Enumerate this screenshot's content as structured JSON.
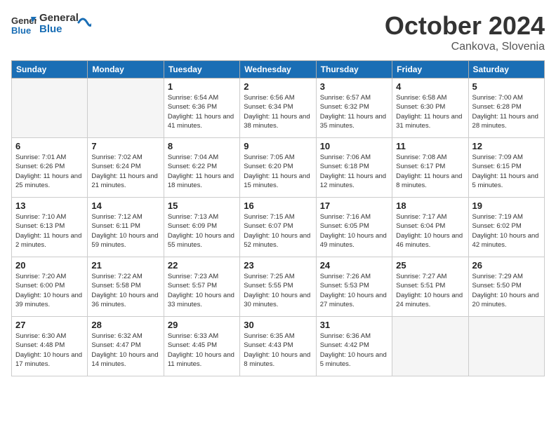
{
  "header": {
    "logo_line1": "General",
    "logo_line2": "Blue",
    "month": "October 2024",
    "location": "Cankova, Slovenia"
  },
  "weekdays": [
    "Sunday",
    "Monday",
    "Tuesday",
    "Wednesday",
    "Thursday",
    "Friday",
    "Saturday"
  ],
  "weeks": [
    [
      {
        "day": "",
        "sunrise": "",
        "sunset": "",
        "daylight": ""
      },
      {
        "day": "",
        "sunrise": "",
        "sunset": "",
        "daylight": ""
      },
      {
        "day": "1",
        "sunrise": "Sunrise: 6:54 AM",
        "sunset": "Sunset: 6:36 PM",
        "daylight": "Daylight: 11 hours and 41 minutes."
      },
      {
        "day": "2",
        "sunrise": "Sunrise: 6:56 AM",
        "sunset": "Sunset: 6:34 PM",
        "daylight": "Daylight: 11 hours and 38 minutes."
      },
      {
        "day": "3",
        "sunrise": "Sunrise: 6:57 AM",
        "sunset": "Sunset: 6:32 PM",
        "daylight": "Daylight: 11 hours and 35 minutes."
      },
      {
        "day": "4",
        "sunrise": "Sunrise: 6:58 AM",
        "sunset": "Sunset: 6:30 PM",
        "daylight": "Daylight: 11 hours and 31 minutes."
      },
      {
        "day": "5",
        "sunrise": "Sunrise: 7:00 AM",
        "sunset": "Sunset: 6:28 PM",
        "daylight": "Daylight: 11 hours and 28 minutes."
      }
    ],
    [
      {
        "day": "6",
        "sunrise": "Sunrise: 7:01 AM",
        "sunset": "Sunset: 6:26 PM",
        "daylight": "Daylight: 11 hours and 25 minutes."
      },
      {
        "day": "7",
        "sunrise": "Sunrise: 7:02 AM",
        "sunset": "Sunset: 6:24 PM",
        "daylight": "Daylight: 11 hours and 21 minutes."
      },
      {
        "day": "8",
        "sunrise": "Sunrise: 7:04 AM",
        "sunset": "Sunset: 6:22 PM",
        "daylight": "Daylight: 11 hours and 18 minutes."
      },
      {
        "day": "9",
        "sunrise": "Sunrise: 7:05 AM",
        "sunset": "Sunset: 6:20 PM",
        "daylight": "Daylight: 11 hours and 15 minutes."
      },
      {
        "day": "10",
        "sunrise": "Sunrise: 7:06 AM",
        "sunset": "Sunset: 6:18 PM",
        "daylight": "Daylight: 11 hours and 12 minutes."
      },
      {
        "day": "11",
        "sunrise": "Sunrise: 7:08 AM",
        "sunset": "Sunset: 6:17 PM",
        "daylight": "Daylight: 11 hours and 8 minutes."
      },
      {
        "day": "12",
        "sunrise": "Sunrise: 7:09 AM",
        "sunset": "Sunset: 6:15 PM",
        "daylight": "Daylight: 11 hours and 5 minutes."
      }
    ],
    [
      {
        "day": "13",
        "sunrise": "Sunrise: 7:10 AM",
        "sunset": "Sunset: 6:13 PM",
        "daylight": "Daylight: 11 hours and 2 minutes."
      },
      {
        "day": "14",
        "sunrise": "Sunrise: 7:12 AM",
        "sunset": "Sunset: 6:11 PM",
        "daylight": "Daylight: 10 hours and 59 minutes."
      },
      {
        "day": "15",
        "sunrise": "Sunrise: 7:13 AM",
        "sunset": "Sunset: 6:09 PM",
        "daylight": "Daylight: 10 hours and 55 minutes."
      },
      {
        "day": "16",
        "sunrise": "Sunrise: 7:15 AM",
        "sunset": "Sunset: 6:07 PM",
        "daylight": "Daylight: 10 hours and 52 minutes."
      },
      {
        "day": "17",
        "sunrise": "Sunrise: 7:16 AM",
        "sunset": "Sunset: 6:05 PM",
        "daylight": "Daylight: 10 hours and 49 minutes."
      },
      {
        "day": "18",
        "sunrise": "Sunrise: 7:17 AM",
        "sunset": "Sunset: 6:04 PM",
        "daylight": "Daylight: 10 hours and 46 minutes."
      },
      {
        "day": "19",
        "sunrise": "Sunrise: 7:19 AM",
        "sunset": "Sunset: 6:02 PM",
        "daylight": "Daylight: 10 hours and 42 minutes."
      }
    ],
    [
      {
        "day": "20",
        "sunrise": "Sunrise: 7:20 AM",
        "sunset": "Sunset: 6:00 PM",
        "daylight": "Daylight: 10 hours and 39 minutes."
      },
      {
        "day": "21",
        "sunrise": "Sunrise: 7:22 AM",
        "sunset": "Sunset: 5:58 PM",
        "daylight": "Daylight: 10 hours and 36 minutes."
      },
      {
        "day": "22",
        "sunrise": "Sunrise: 7:23 AM",
        "sunset": "Sunset: 5:57 PM",
        "daylight": "Daylight: 10 hours and 33 minutes."
      },
      {
        "day": "23",
        "sunrise": "Sunrise: 7:25 AM",
        "sunset": "Sunset: 5:55 PM",
        "daylight": "Daylight: 10 hours and 30 minutes."
      },
      {
        "day": "24",
        "sunrise": "Sunrise: 7:26 AM",
        "sunset": "Sunset: 5:53 PM",
        "daylight": "Daylight: 10 hours and 27 minutes."
      },
      {
        "day": "25",
        "sunrise": "Sunrise: 7:27 AM",
        "sunset": "Sunset: 5:51 PM",
        "daylight": "Daylight: 10 hours and 24 minutes."
      },
      {
        "day": "26",
        "sunrise": "Sunrise: 7:29 AM",
        "sunset": "Sunset: 5:50 PM",
        "daylight": "Daylight: 10 hours and 20 minutes."
      }
    ],
    [
      {
        "day": "27",
        "sunrise": "Sunrise: 6:30 AM",
        "sunset": "Sunset: 4:48 PM",
        "daylight": "Daylight: 10 hours and 17 minutes."
      },
      {
        "day": "28",
        "sunrise": "Sunrise: 6:32 AM",
        "sunset": "Sunset: 4:47 PM",
        "daylight": "Daylight: 10 hours and 14 minutes."
      },
      {
        "day": "29",
        "sunrise": "Sunrise: 6:33 AM",
        "sunset": "Sunset: 4:45 PM",
        "daylight": "Daylight: 10 hours and 11 minutes."
      },
      {
        "day": "30",
        "sunrise": "Sunrise: 6:35 AM",
        "sunset": "Sunset: 4:43 PM",
        "daylight": "Daylight: 10 hours and 8 minutes."
      },
      {
        "day": "31",
        "sunrise": "Sunrise: 6:36 AM",
        "sunset": "Sunset: 4:42 PM",
        "daylight": "Daylight: 10 hours and 5 minutes."
      },
      {
        "day": "",
        "sunrise": "",
        "sunset": "",
        "daylight": ""
      },
      {
        "day": "",
        "sunrise": "",
        "sunset": "",
        "daylight": ""
      }
    ]
  ]
}
